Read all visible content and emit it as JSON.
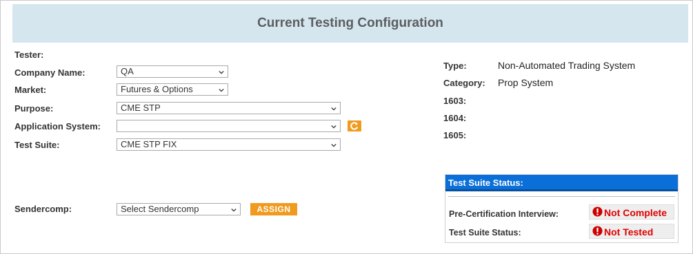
{
  "header": {
    "title": "Current Testing Configuration"
  },
  "form": {
    "tester_label": "Tester:",
    "company_label": "Company Name:",
    "company_value": "QA",
    "market_label": "Market:",
    "market_value": "Futures & Options",
    "purpose_label": "Purpose:",
    "purpose_value": "CME STP",
    "app_system_label": "Application System:",
    "app_system_value": "",
    "test_suite_label": "Test Suite:",
    "test_suite_value": "CME STP FIX",
    "sendercomp_label": "Sendercomp:",
    "sendercomp_value": "Select Sendercomp",
    "assign_label": "ASSIGN"
  },
  "info": {
    "type_label": "Type:",
    "type_value": "Non-Automated Trading System",
    "category_label": "Category:",
    "category_value": "Prop System",
    "f1603_label": "1603:",
    "f1604_label": "1604:",
    "f1605_label": "1605:"
  },
  "status": {
    "title": "Test Suite Status:",
    "precert_label": "Pre-Certification Interview:",
    "precert_value": "Not Complete",
    "suite_label": "Test Suite Status:",
    "suite_value": "Not Tested"
  },
  "colors": {
    "header_bg": "#d6e6ef",
    "accent_orange": "#f09a1e",
    "status_header_blue": "#0a6fd8",
    "error_red": "#e00000"
  },
  "icons": {
    "dropdown": "chevron-down-icon",
    "refresh": "refresh-icon",
    "error": "error-icon"
  }
}
